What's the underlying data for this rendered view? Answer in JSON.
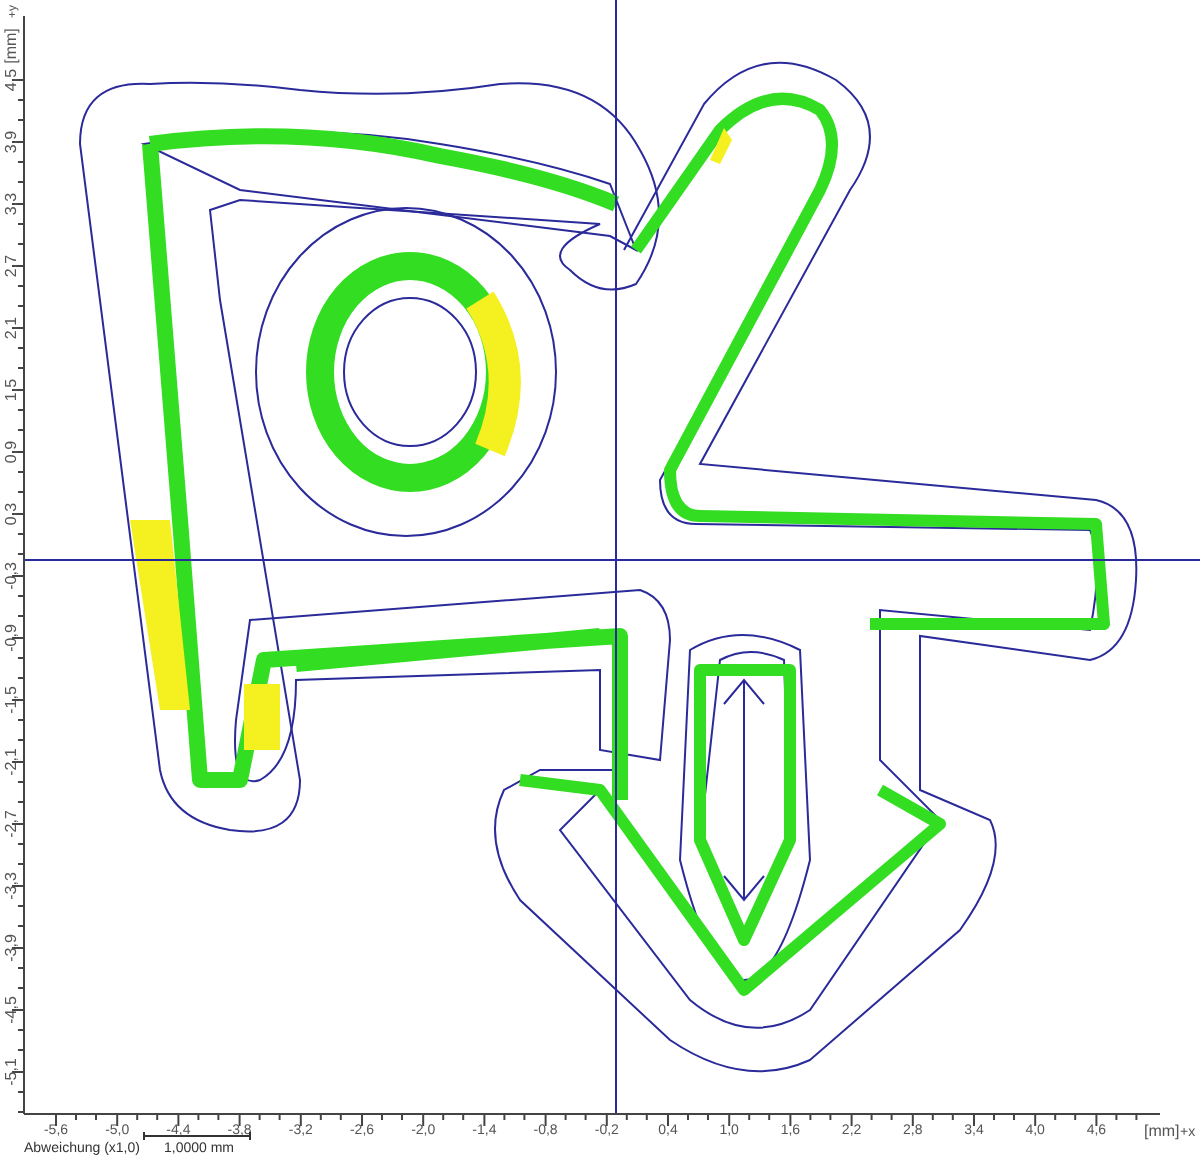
{
  "plot": {
    "x_axis": {
      "ticks": [
        "-5,6",
        "-5,0",
        "-4,4",
        "-3,8",
        "-3,2",
        "-2,6",
        "-2,0",
        "-1,4",
        "-0,8",
        "-0,2",
        "0,4",
        "1,0",
        "1,6",
        "2,2",
        "2,8",
        "3,4",
        "4,0",
        "4,6"
      ],
      "unit": "[mm]",
      "sign": "+x"
    },
    "y_axis": {
      "ticks": [
        "4,5",
        "3,9",
        "3,3",
        "2,7",
        "2,1",
        "1,5",
        "0,9",
        "0,3",
        "-0,3",
        "-0,9",
        "-1,5",
        "-2,1",
        "-2,7",
        "-3,3",
        "-3,9",
        "-4,5",
        "-5,1"
      ],
      "unit": "[mm]",
      "sign": "+y"
    }
  },
  "legend": {
    "title": "Abweichung (x1,0)",
    "scale": "1,0000 mm"
  }
}
